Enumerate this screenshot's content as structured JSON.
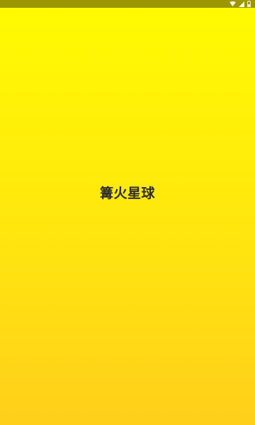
{
  "app": {
    "title": "篝火星球"
  },
  "status_bar": {
    "icons": [
      "wifi-icon",
      "signal-icon",
      "battery-icon"
    ],
    "background_color": "#9C9600"
  },
  "colors": {
    "gradient_top": "#FFFB00",
    "gradient_bottom": "#FFCF1A",
    "title_text": "#2E2E2E"
  }
}
